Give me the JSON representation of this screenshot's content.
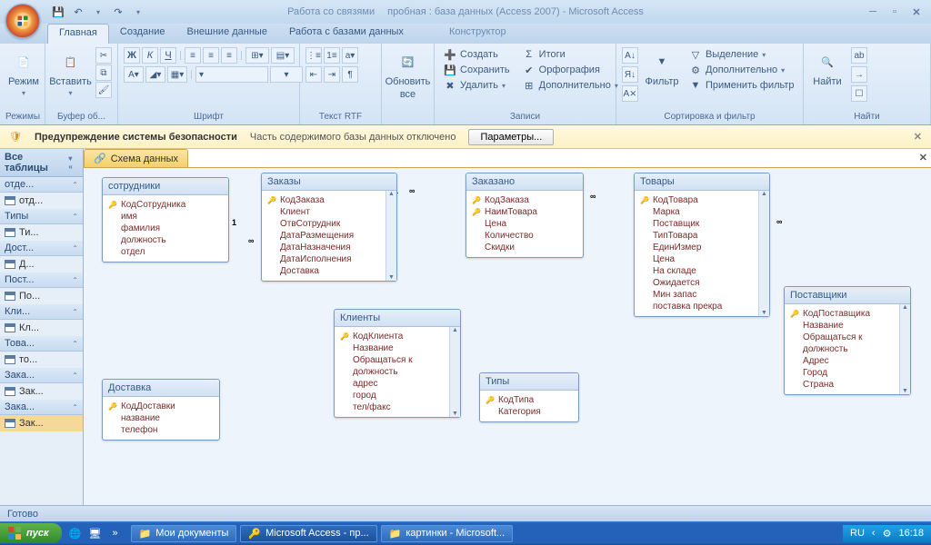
{
  "title": {
    "relationships": "Работа со связями",
    "app": "пробная : база данных (Access 2007) - Microsoft Access"
  },
  "tabs": {
    "home": "Главная",
    "create": "Создание",
    "extdata": "Внешние данные",
    "dbwork": "Работа с базами данных",
    "designer": "Конструктор"
  },
  "ribbon": {
    "modes": {
      "btn": "Режим",
      "label": "Режимы"
    },
    "clipboard": {
      "paste": "Вставить",
      "label": "Буфер об..."
    },
    "font": {
      "label": "Шрифт"
    },
    "rtf": {
      "label": "Текст RTF"
    },
    "refresh": {
      "btn": "Обновить",
      "btn2": "все",
      "label": ""
    },
    "records": {
      "create": "Создать",
      "save": "Сохранить",
      "delete": "Удалить",
      "totals": "Итоги",
      "spell": "Орфография",
      "more": "Дополнительно",
      "label": "Записи"
    },
    "sortfilter": {
      "filter": "Фильтр",
      "select": "Выделение",
      "more": "Дополнительно",
      "apply": "Применить фильтр",
      "label": "Сортировка и фильтр"
    },
    "find": {
      "btn": "Найти",
      "label": "Найти"
    }
  },
  "security": {
    "title": "Предупреждение системы безопасности",
    "msg": "Часть содержимого базы данных отключено",
    "btn": "Параметры..."
  },
  "nav": {
    "header": "Все таблицы",
    "groups": [
      {
        "hdr": "отде...",
        "items": [
          "отд..."
        ]
      },
      {
        "hdr": "Типы",
        "items": [
          "Ти..."
        ]
      },
      {
        "hdr": "Дост...",
        "items": [
          "Д..."
        ]
      },
      {
        "hdr": "Пост...",
        "items": [
          "По..."
        ]
      },
      {
        "hdr": "Кли...",
        "items": [
          "Кл..."
        ]
      },
      {
        "hdr": "Това...",
        "items": [
          "то..."
        ]
      },
      {
        "hdr": "Зака...",
        "items": [
          "Зак..."
        ]
      },
      {
        "hdr": "Зака...",
        "items": [
          "Зак..."
        ]
      }
    ]
  },
  "doctab": "Схема данных",
  "tables": {
    "sotrudniki": {
      "title": "сотрудники",
      "fields": [
        [
          "КодСотрудника",
          true
        ],
        [
          "имя",
          false
        ],
        [
          "фамилия",
          false
        ],
        [
          "должность",
          false
        ],
        [
          "отдел",
          false
        ]
      ]
    },
    "zakazy": {
      "title": "Заказы",
      "fields": [
        [
          "КодЗаказа",
          true
        ],
        [
          "Клиент",
          false
        ],
        [
          "ОтвСотрудник",
          false
        ],
        [
          "ДатаРазмещения",
          false
        ],
        [
          "ДатаНазначения",
          false
        ],
        [
          "ДатаИсполнения",
          false
        ],
        [
          "Доставка",
          false
        ]
      ]
    },
    "zakazano": {
      "title": "Заказано",
      "fields": [
        [
          "КодЗаказа",
          true
        ],
        [
          "НаимТовара",
          true
        ],
        [
          "Цена",
          false
        ],
        [
          "Количество",
          false
        ],
        [
          "Скидки",
          false
        ]
      ]
    },
    "tovary": {
      "title": "Товары",
      "fields": [
        [
          "КодТовара",
          true
        ],
        [
          "Марка",
          false
        ],
        [
          "Поставщик",
          false
        ],
        [
          "ТипТовара",
          false
        ],
        [
          "ЕдинИзмер",
          false
        ],
        [
          "Цена",
          false
        ],
        [
          "На складе",
          false
        ],
        [
          "Ожидается",
          false
        ],
        [
          "Мин запас",
          false
        ],
        [
          "поставка прекра",
          false
        ]
      ]
    },
    "postavshiki": {
      "title": "Поставщики",
      "fields": [
        [
          "КодПоставщика",
          true
        ],
        [
          "Название",
          false
        ],
        [
          "Обращаться к",
          false
        ],
        [
          "должность",
          false
        ],
        [
          "Адрес",
          false
        ],
        [
          "Город",
          false
        ],
        [
          "Страна",
          false
        ]
      ]
    },
    "klienty": {
      "title": "Клиенты",
      "fields": [
        [
          "КодКлиента",
          true
        ],
        [
          "Название",
          false
        ],
        [
          "Обращаться к",
          false
        ],
        [
          "должность",
          false
        ],
        [
          "адрес",
          false
        ],
        [
          "город",
          false
        ],
        [
          "тел/факс",
          false
        ]
      ]
    },
    "tipy": {
      "title": "Типы",
      "fields": [
        [
          "КодТипа",
          true
        ],
        [
          "Категория",
          false
        ]
      ]
    },
    "dostavka": {
      "title": "Доставка",
      "fields": [
        [
          "КодДоставки",
          true
        ],
        [
          "название",
          false
        ],
        [
          "телефон",
          false
        ]
      ]
    }
  },
  "status": "Готово",
  "taskbar": {
    "start": "пуск",
    "tasks": [
      "Мои документы",
      "Microsoft Access - пр...",
      "картинки - Microsoft..."
    ],
    "lang": "RU",
    "time": "16:18"
  }
}
